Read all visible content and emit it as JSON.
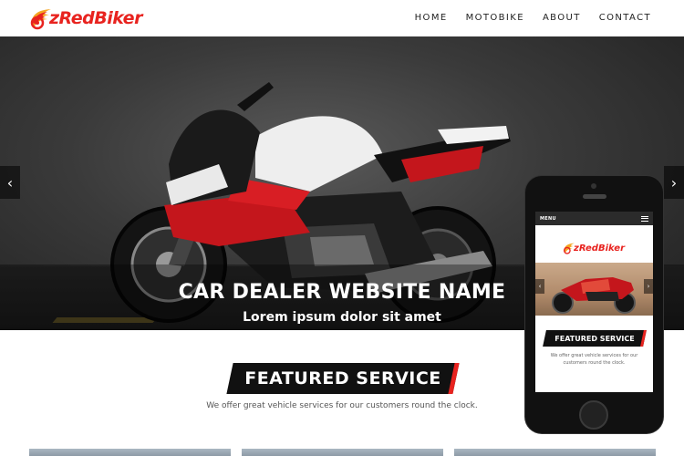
{
  "brand": {
    "name": "zRedBiker",
    "color": "#e8231f"
  },
  "nav": {
    "items": [
      "HOME",
      "MOTOBIKE",
      "ABOUT",
      "CONTACT"
    ]
  },
  "hero": {
    "title": "CAR DEALER WEBSITE NAME",
    "subtitle": "Lorem ipsum dolor sit amet",
    "prev_icon": "chevron-left-icon",
    "next_icon": "chevron-right-icon",
    "prev_glyph": "‹",
    "next_glyph": "›"
  },
  "featured": {
    "title": "FEATURED SERVICE",
    "description": "We offer great vehicle services for our customers round the clock."
  },
  "phone": {
    "menu_label": "MENU",
    "brand_name": "zRedBiker",
    "featured_title": "FEATURED SERVICE",
    "featured_description": "We offer great vehicle services for our customers round the clock.",
    "prev_glyph": "‹",
    "next_glyph": "›"
  }
}
